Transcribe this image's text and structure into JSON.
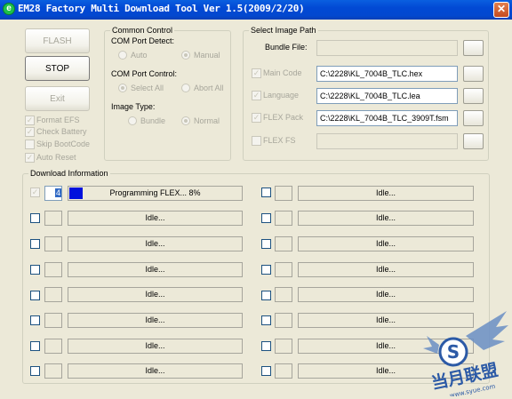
{
  "window": {
    "title": "EM28 Factory Multi Download Tool Ver 1.5(2009/2/20)",
    "close_glyph": "✕"
  },
  "actions": {
    "flash": "FLASH",
    "stop": "STOP",
    "exit": "Exit"
  },
  "options": [
    {
      "label": "Format EFS",
      "checked": true
    },
    {
      "label": "Check Battery",
      "checked": true
    },
    {
      "label": "Skip BootCode",
      "checked": false
    },
    {
      "label": "Auto Reset",
      "checked": true
    }
  ],
  "common_control": {
    "title": "Common Control",
    "port_detect": {
      "label": "COM Port Detect:",
      "auto": "Auto",
      "manual": "Manual",
      "selected": "Manual"
    },
    "port_control": {
      "label": "COM Port Control:",
      "select_all": "Select All",
      "abort_all": "Abort All",
      "selected": "Select All"
    },
    "image_type": {
      "label": "Image Type:",
      "bundle": "Bundle",
      "normal": "Normal",
      "selected": "Normal"
    }
  },
  "image_path": {
    "title": "Select Image Path",
    "bundle_file": {
      "label": "Bundle File:",
      "value": ""
    },
    "rows": [
      {
        "label": "Main Code",
        "checked": true,
        "value": "C:\\2228\\KL_7004B_TLC.hex"
      },
      {
        "label": "Language",
        "checked": true,
        "value": "C:\\2228\\KL_7004B_TLC.lea"
      },
      {
        "label": "FLEX Pack",
        "checked": true,
        "value": "C:\\2228\\KL_7004B_TLC_3909T.fsm"
      },
      {
        "label": "FLEX FS",
        "checked": false,
        "value": ""
      }
    ]
  },
  "download": {
    "title": "Download Information",
    "active": {
      "port": "4",
      "status": "Programming FLEX... 8%",
      "progress": 0.08,
      "checked": true
    },
    "idle_label": "Idle..."
  },
  "colors": {
    "titlebar": "#0348cf",
    "progress": "#0011dd",
    "window_bg": "#ece9d8"
  },
  "watermark": {
    "brand": "当月联盟",
    "url": "www.syue.com",
    "logo_letter": "S"
  }
}
